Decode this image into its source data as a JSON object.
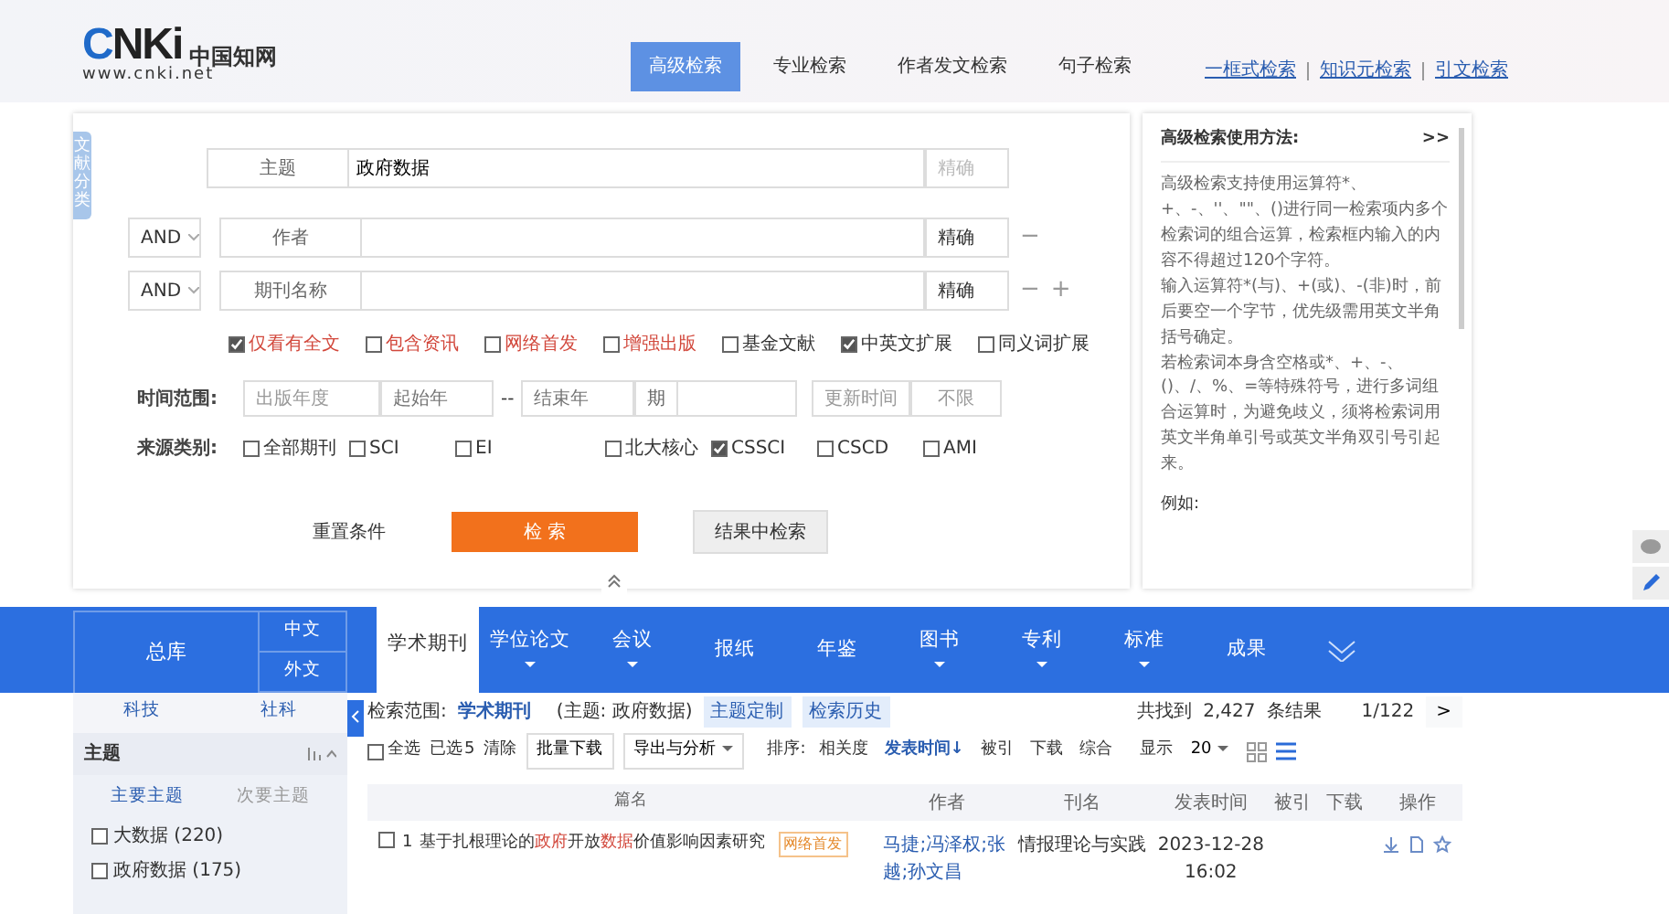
{
  "logo": {
    "mark": "CNKi",
    "name": "中国知网",
    "url": "www.cnki.net"
  },
  "search_tabs": [
    {
      "label": "高级检索",
      "selected": true
    },
    {
      "label": "专业检索",
      "selected": false
    },
    {
      "label": "作者发文检索",
      "selected": false
    },
    {
      "label": "句子检索",
      "selected": false
    }
  ],
  "search_links": [
    "一框式检索",
    "知识元检索",
    "引文检索"
  ],
  "side_tab": "文献分类",
  "query_rows": [
    {
      "field": "主题",
      "value": "政府数据",
      "match": "精确",
      "match_disabled": true,
      "controls": []
    },
    {
      "operator": "AND",
      "field": "作者",
      "match": "精确",
      "match_disabled": false,
      "controls": [
        "−"
      ]
    },
    {
      "operator": "AND",
      "field": "期刊名称",
      "match": "精确",
      "match_disabled": false,
      "controls": [
        "−",
        "+"
      ]
    }
  ],
  "options": [
    {
      "label": "仅看有全文",
      "checked": true,
      "highlight": true
    },
    {
      "label": "包含资讯",
      "checked": false,
      "highlight": true
    },
    {
      "label": "网络首发",
      "checked": false,
      "highlight": true
    },
    {
      "label": "增强出版",
      "checked": false,
      "highlight": true
    },
    {
      "label": "基金文献",
      "checked": false,
      "highlight": false
    },
    {
      "label": "中英文扩展",
      "checked": true,
      "highlight": false
    },
    {
      "label": "同义词扩展",
      "checked": false,
      "highlight": false
    }
  ],
  "time_range": {
    "label": "时间范围:",
    "year_type": "出版年度",
    "start_placeholder": "起始年",
    "separator": "--",
    "end_placeholder": "结束年",
    "issue_label": "期",
    "update_label": "更新时间",
    "update_value": "不限"
  },
  "sources": {
    "label": "来源类别:",
    "items": [
      {
        "label": "全部期刊",
        "checked": false
      },
      {
        "label": "SCI",
        "checked": false
      },
      {
        "label": "EI",
        "checked": false
      },
      {
        "label": "北大核心",
        "checked": false
      },
      {
        "label": "CSSCI",
        "checked": true
      },
      {
        "label": "CSCD",
        "checked": false
      },
      {
        "label": "AMI",
        "checked": false
      }
    ]
  },
  "actions": {
    "reset": "重置条件",
    "search": "检 索",
    "within": "结果中检索"
  },
  "help": {
    "title": "高级检索使用方法:",
    "toggle": ">>",
    "paragraphs": [
      "高级检索支持使用运算符*、+、-、''、\"\"、()进行同一检索项内多个检索词的组合运算，检索框内输入的内容不得超过120个字符。",
      "输入运算符*(与)、+(或)、-(非)时，前后要空一个字节，优先级需用英文半角括号确定。",
      "若检索词本身含空格或*、+、-、()、/、%、=等特殊符号，进行多词组合运算时，为避免歧义，须将检索词用英文半角单引号或英文半角双引号引起来。"
    ],
    "example": "例如:"
  },
  "db_tabs": {
    "all": "总库",
    "languages": [
      {
        "label": "中文",
        "selected": false
      },
      {
        "label": "外文",
        "selected": false
      }
    ],
    "items": [
      {
        "label": "学术期刊",
        "selected": true,
        "has_menu": false
      },
      {
        "label": "学位论文",
        "selected": false,
        "has_menu": true
      },
      {
        "label": "会议",
        "selected": false,
        "has_menu": true
      },
      {
        "label": "报纸",
        "selected": false,
        "has_menu": false
      },
      {
        "label": "年鉴",
        "selected": false,
        "has_menu": false
      },
      {
        "label": "图书",
        "selected": false,
        "has_menu": true
      },
      {
        "label": "专利",
        "selected": false,
        "has_menu": true
      },
      {
        "label": "标准",
        "selected": false,
        "has_menu": true
      },
      {
        "label": "成果",
        "selected": false,
        "has_menu": false
      }
    ]
  },
  "sidebar": {
    "tabs": [
      {
        "label": "科技",
        "selected": false
      },
      {
        "label": "社科",
        "selected": false
      }
    ],
    "group": "主题",
    "subtabs": [
      {
        "label": "主要主题",
        "selected": true
      },
      {
        "label": "次要主题",
        "selected": false
      }
    ],
    "items": [
      {
        "label": "大数据 (220)",
        "checked": false
      },
      {
        "label": "政府数据 (175)",
        "checked": false
      }
    ]
  },
  "results": {
    "scope_label": "检索范围:",
    "scope": "学术期刊",
    "query": "(主题: 政府数据)",
    "tags": [
      "主题定制",
      "检索历史"
    ],
    "found_label": "共找到",
    "count": "2,427",
    "count_suffix": "条结果",
    "page": "1/122",
    "next": ">",
    "toolbar": {
      "select_all": "全选",
      "select_all_checked": false,
      "selected_label": "已选",
      "selected_count": "5",
      "clear": "清除",
      "buttons": [
        {
          "label": "批量下载",
          "has_menu": false
        },
        {
          "label": "导出与分析",
          "has_menu": true
        }
      ],
      "sort_label": "排序:",
      "sorts": [
        {
          "label": "相关度",
          "selected": false
        },
        {
          "label": "发表时间↓",
          "selected": true
        },
        {
          "label": "被引",
          "selected": false
        },
        {
          "label": "下载",
          "selected": false
        },
        {
          "label": "综合",
          "selected": false
        }
      ],
      "display_label": "显示",
      "page_size": "20",
      "views": [
        {
          "kind": "grid",
          "selected": false
        },
        {
          "kind": "list",
          "selected": true
        }
      ]
    },
    "columns": [
      "篇名",
      "作者",
      "刊名",
      "发表时间",
      "被引",
      "下载",
      "操作"
    ],
    "rows": [
      {
        "index": "1",
        "checked": false,
        "title": [
          {
            "text": "基于扎根理论的",
            "hit": false
          },
          {
            "text": "政府",
            "hit": true
          },
          {
            "text": "开放",
            "hit": false
          },
          {
            "text": "数据",
            "hit": true
          },
          {
            "text": "价值影响因素研究",
            "hit": false
          }
        ],
        "badge": "网络首发",
        "authors": "马捷;冯泽权;张越;孙文昌",
        "journal": "情报理论与实践",
        "date": "2023-12-28 16:02"
      }
    ]
  }
}
